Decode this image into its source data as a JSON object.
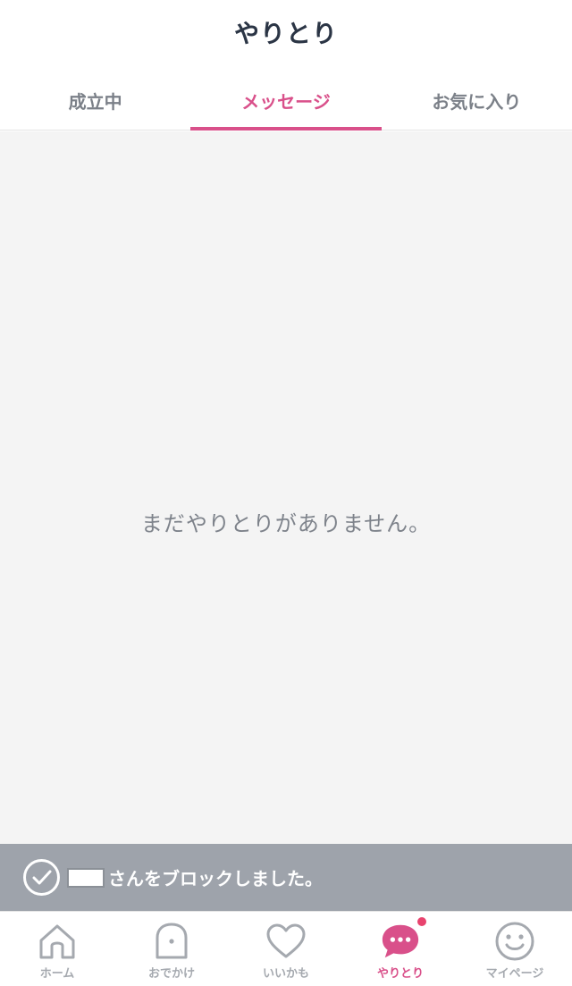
{
  "header": {
    "title": "やりとり"
  },
  "tabs": [
    {
      "label": "成立中",
      "active": false
    },
    {
      "label": "メッセージ",
      "active": true
    },
    {
      "label": "お気に入り",
      "active": false
    }
  ],
  "content": {
    "empty_message": "まだやりとりがありません。"
  },
  "toast": {
    "message": "さんをブロックしました。",
    "icon": "check-circle-icon"
  },
  "tabbar": {
    "items": [
      {
        "label": "ホーム",
        "icon": "home-icon"
      },
      {
        "label": "おでかけ",
        "icon": "ghost-icon"
      },
      {
        "label": "いいかも",
        "icon": "heart-icon"
      },
      {
        "label": "やりとり",
        "icon": "chat-bubble-icon",
        "active": true,
        "has_notification": true
      },
      {
        "label": "マイページ",
        "icon": "smiley-face-icon"
      }
    ]
  },
  "colors": {
    "accent": "#d9508a",
    "toast_bg": "#9ea3ab",
    "content_bg": "#f4f4f4",
    "notification": "#e8436e"
  }
}
